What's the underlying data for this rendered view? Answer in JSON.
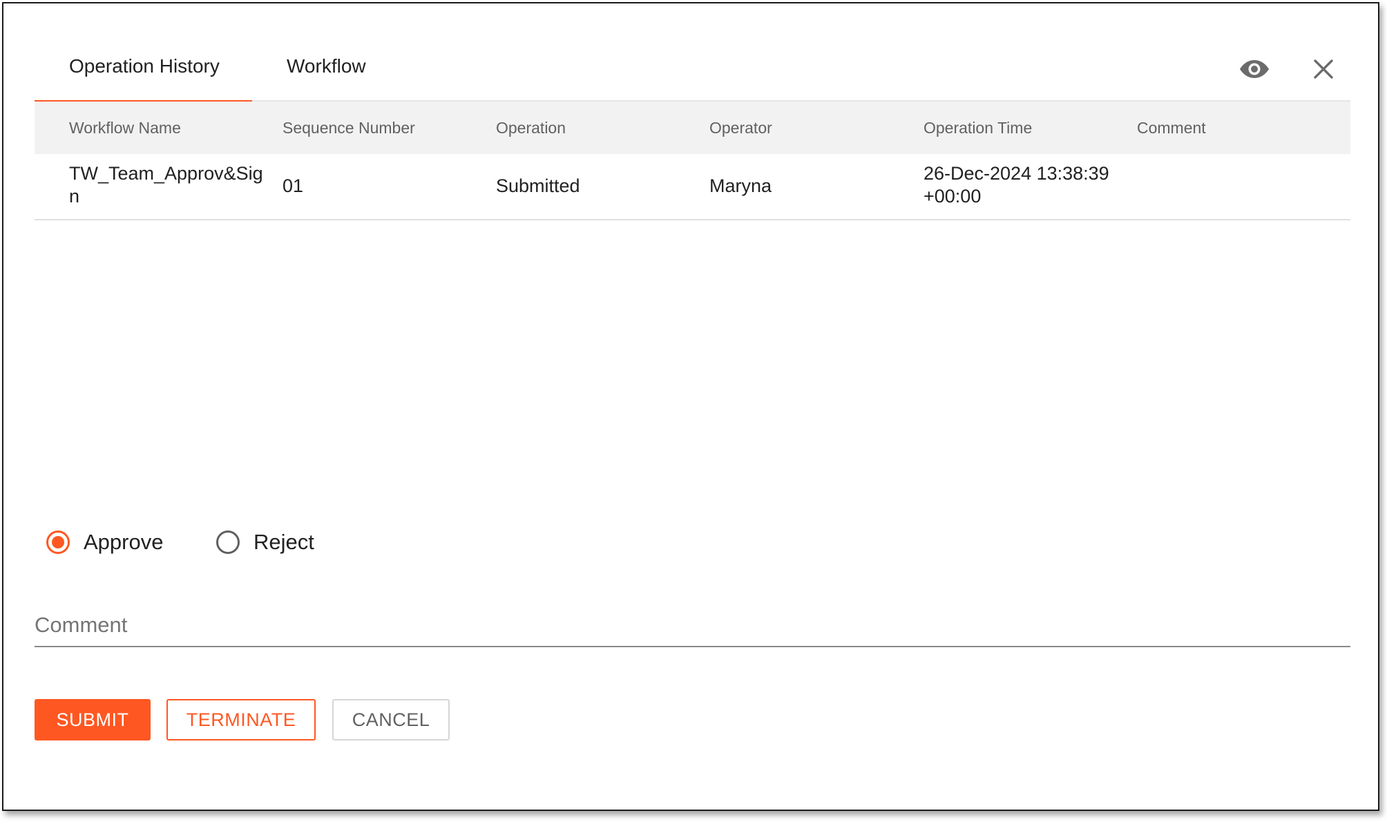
{
  "tabs": [
    {
      "label": "Operation History",
      "active": true
    },
    {
      "label": "Workflow",
      "active": false
    }
  ],
  "icons": {
    "view": "eye-icon",
    "close": "close-icon"
  },
  "table": {
    "headers": [
      "Workflow Name",
      "Sequence Number",
      "Operation",
      "Operator",
      "Operation Time",
      "Comment"
    ],
    "rows": [
      {
        "workflow_name": "TW_Team_Approv&Sign",
        "sequence_number": "01",
        "operation": "Submitted",
        "operator": "Maryna",
        "operation_time": "26-Dec-2024 13:38:39 +00:00",
        "comment": ""
      }
    ]
  },
  "decision": {
    "options": [
      "Approve",
      "Reject"
    ],
    "selected": "Approve"
  },
  "comment_field": {
    "placeholder": "Comment",
    "value": ""
  },
  "buttons": {
    "submit": "SUBMIT",
    "terminate": "TERMINATE",
    "cancel": "CANCEL"
  },
  "colors": {
    "accent": "#ff5722",
    "header_bg": "#f2f2f2"
  }
}
